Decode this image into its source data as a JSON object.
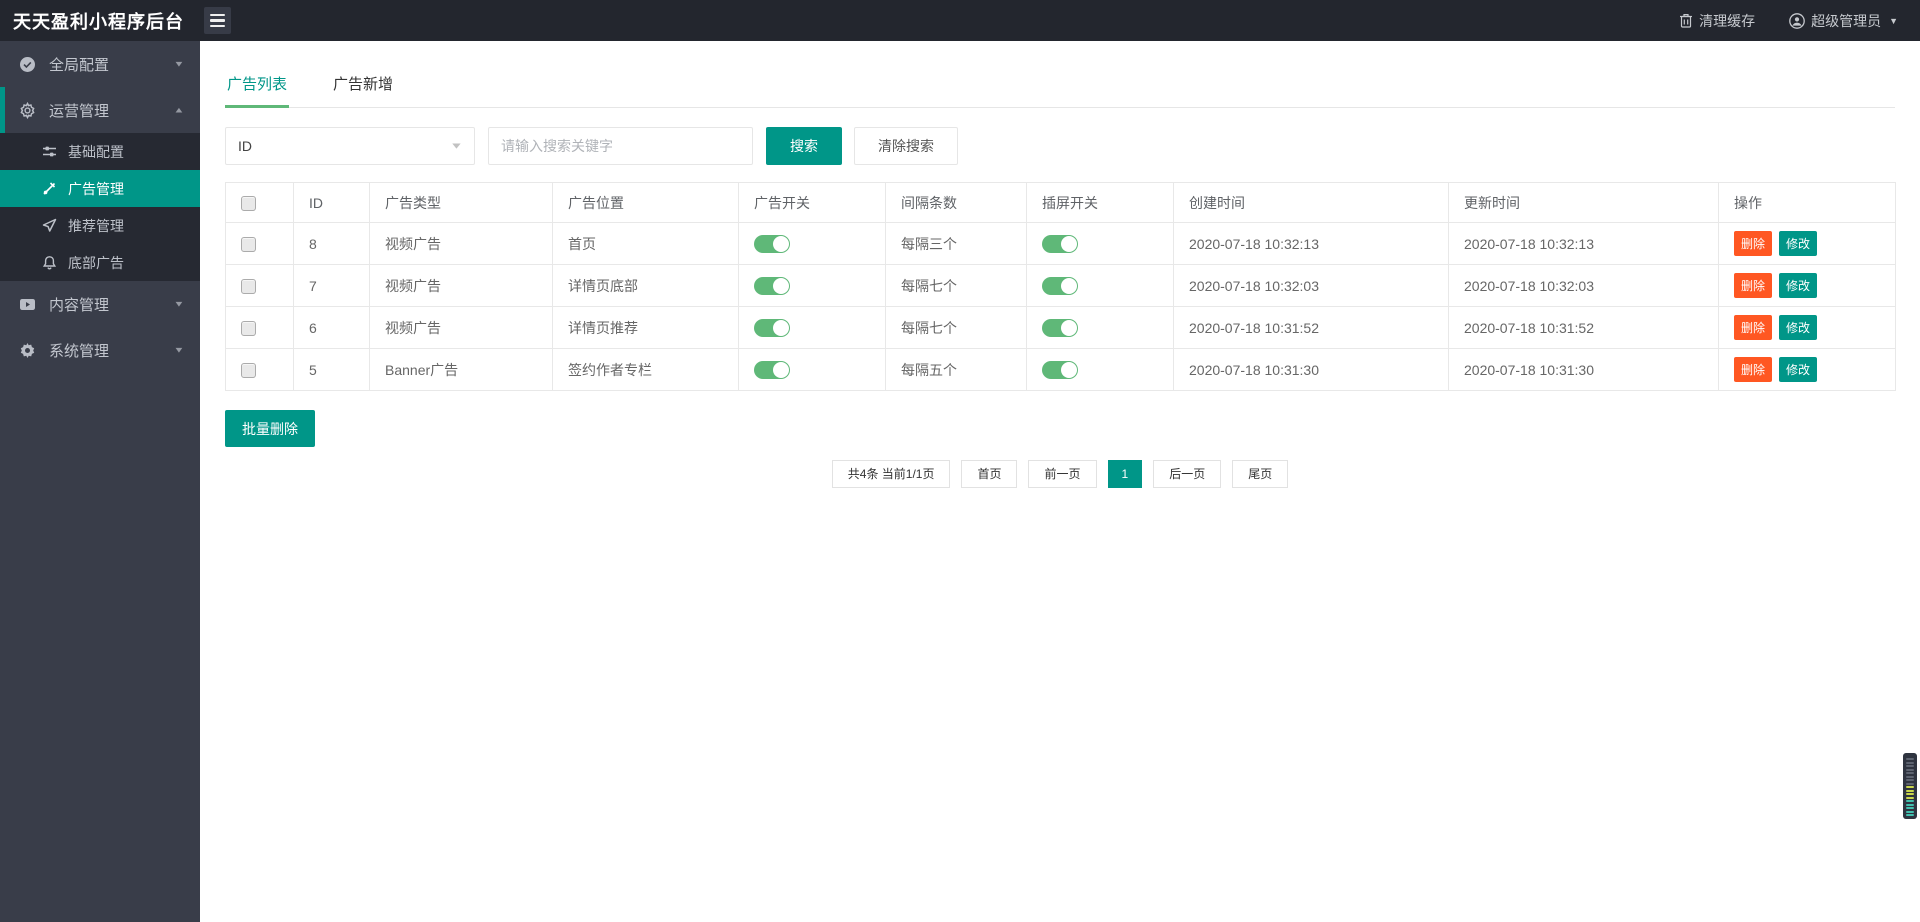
{
  "header": {
    "title": "天天盈利小程序后台",
    "menu_icon": "hamburger-icon",
    "clear_cache_label": "清理缓存",
    "clear_cache_icon": "trash-icon",
    "user_label": "超级管理员",
    "user_icon": "user-circle-icon",
    "user_caret": "▼"
  },
  "sidebar": {
    "items": [
      {
        "label": "全局配置",
        "icon": "globe-icon",
        "caret": "▼"
      },
      {
        "label": "运营管理",
        "icon": "gear-outline-icon",
        "caret": "▲",
        "children": [
          {
            "label": "基础配置",
            "icon": "sliders-icon"
          },
          {
            "label": "广告管理",
            "icon": "promotion-icon",
            "active": true
          },
          {
            "label": "推荐管理",
            "icon": "send-icon"
          },
          {
            "label": "底部广告",
            "icon": "bell-icon"
          }
        ]
      },
      {
        "label": "内容管理",
        "icon": "video-icon",
        "caret": "▼"
      },
      {
        "label": "系统管理",
        "icon": "gear-filled-icon",
        "caret": "▼"
      }
    ]
  },
  "tabs": [
    {
      "label": "广告列表",
      "active": true
    },
    {
      "label": "广告新增",
      "active": false
    }
  ],
  "search": {
    "field_selected": "ID",
    "field_caret": "▼",
    "keyword_placeholder": "请输入搜索关键字",
    "search_label": "搜索",
    "clear_label": "清除搜索"
  },
  "table": {
    "headers": [
      "ID",
      "广告类型",
      "广告位置",
      "广告开关",
      "间隔条数",
      "插屏开关",
      "创建时间",
      "更新时间",
      "操作"
    ],
    "actions": {
      "delete": "删除",
      "edit": "修改"
    },
    "rows": [
      {
        "id": "8",
        "type": "视频广告",
        "position": "首页",
        "ad_switch": true,
        "interval": "每隔三个",
        "screen_switch": true,
        "created": "2020-07-18 10:32:13",
        "updated": "2020-07-18 10:32:13"
      },
      {
        "id": "7",
        "type": "视频广告",
        "position": "详情页底部",
        "ad_switch": true,
        "interval": "每隔七个",
        "screen_switch": true,
        "created": "2020-07-18 10:32:03",
        "updated": "2020-07-18 10:32:03"
      },
      {
        "id": "6",
        "type": "视频广告",
        "position": "详情页推荐",
        "ad_switch": true,
        "interval": "每隔七个",
        "screen_switch": true,
        "created": "2020-07-18 10:31:52",
        "updated": "2020-07-18 10:31:52"
      },
      {
        "id": "5",
        "type": "Banner广告",
        "position": "签约作者专栏",
        "ad_switch": true,
        "interval": "每隔五个",
        "screen_switch": true,
        "created": "2020-07-18 10:31:30",
        "updated": "2020-07-18 10:31:30"
      }
    ]
  },
  "batch_delete_label": "批量删除",
  "pagination": {
    "summary": "共4条 当前1/1页",
    "first": "首页",
    "prev": "前一页",
    "current_page": "1",
    "next": "后一页",
    "last": "尾页"
  },
  "colors": {
    "teal": "#009688",
    "tab_underline_green": "#5fb878",
    "switch_on_green": "#5fb878",
    "danger_orange": "#ff5722",
    "header_bg": "#23262e",
    "sidebar_bg": "#393d49",
    "submenu_bg": "#262932"
  }
}
